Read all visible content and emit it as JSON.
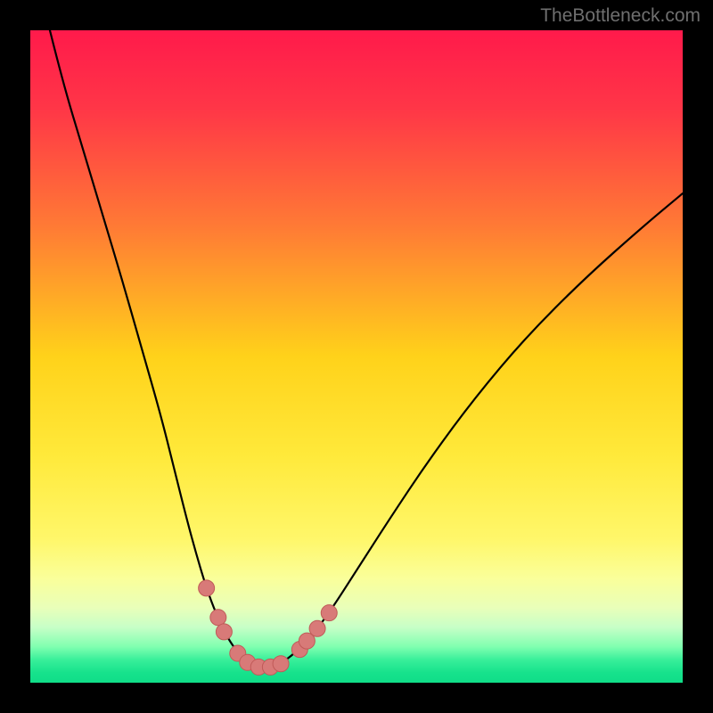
{
  "attribution": "TheBottleneck.com",
  "colors": {
    "bg_black": "#000000",
    "curve": "#000000",
    "marker_fill": "#d87a78",
    "marker_stroke": "#c05a58",
    "gradient_stops": [
      {
        "offset": 0.0,
        "color": "#ff1a4b"
      },
      {
        "offset": 0.12,
        "color": "#ff3647"
      },
      {
        "offset": 0.3,
        "color": "#ff7a35"
      },
      {
        "offset": 0.5,
        "color": "#ffd21a"
      },
      {
        "offset": 0.65,
        "color": "#ffe93a"
      },
      {
        "offset": 0.78,
        "color": "#fff76a"
      },
      {
        "offset": 0.84,
        "color": "#faff9a"
      },
      {
        "offset": 0.885,
        "color": "#e9ffb9"
      },
      {
        "offset": 0.915,
        "color": "#c7ffc7"
      },
      {
        "offset": 0.945,
        "color": "#80ffb0"
      },
      {
        "offset": 0.965,
        "color": "#38ef9a"
      },
      {
        "offset": 0.985,
        "color": "#16e28c"
      },
      {
        "offset": 1.0,
        "color": "#10dd88"
      }
    ]
  },
  "chart_data": {
    "type": "line",
    "title": "",
    "xlabel": "",
    "ylabel": "",
    "xlim": [
      0,
      100
    ],
    "ylim": [
      0,
      100
    ],
    "legend": false,
    "grid": false,
    "series": [
      {
        "name": "bottleneck-curve",
        "x": [
          3,
          5,
          8,
          11,
          14,
          17,
          20,
          22,
          24,
          25.5,
          27,
          28.5,
          30,
          31.5,
          33,
          34.7,
          36.5,
          38.5,
          40.5,
          43,
          46,
          50,
          55,
          61,
          68,
          76,
          85,
          94,
          100
        ],
        "y": [
          100,
          92,
          82,
          72,
          62,
          51.5,
          41,
          33,
          25,
          19.5,
          14.5,
          10.5,
          7.3,
          5.0,
          3.3,
          2.3,
          2.3,
          3.0,
          4.5,
          7.0,
          11,
          17.2,
          25,
          34,
          43.5,
          53,
          62,
          70,
          75
        ]
      }
    ],
    "markers": [
      {
        "x": 27.0,
        "y": 14.5
      },
      {
        "x": 28.8,
        "y": 10.0
      },
      {
        "x": 29.7,
        "y": 7.8
      },
      {
        "x": 31.8,
        "y": 4.5
      },
      {
        "x": 33.3,
        "y": 3.1
      },
      {
        "x": 35.0,
        "y": 2.4
      },
      {
        "x": 36.8,
        "y": 2.4
      },
      {
        "x": 38.4,
        "y": 2.9
      },
      {
        "x": 41.3,
        "y": 5.1
      },
      {
        "x": 42.4,
        "y": 6.4
      },
      {
        "x": 44.0,
        "y": 8.3
      },
      {
        "x": 45.8,
        "y": 10.7
      }
    ]
  }
}
